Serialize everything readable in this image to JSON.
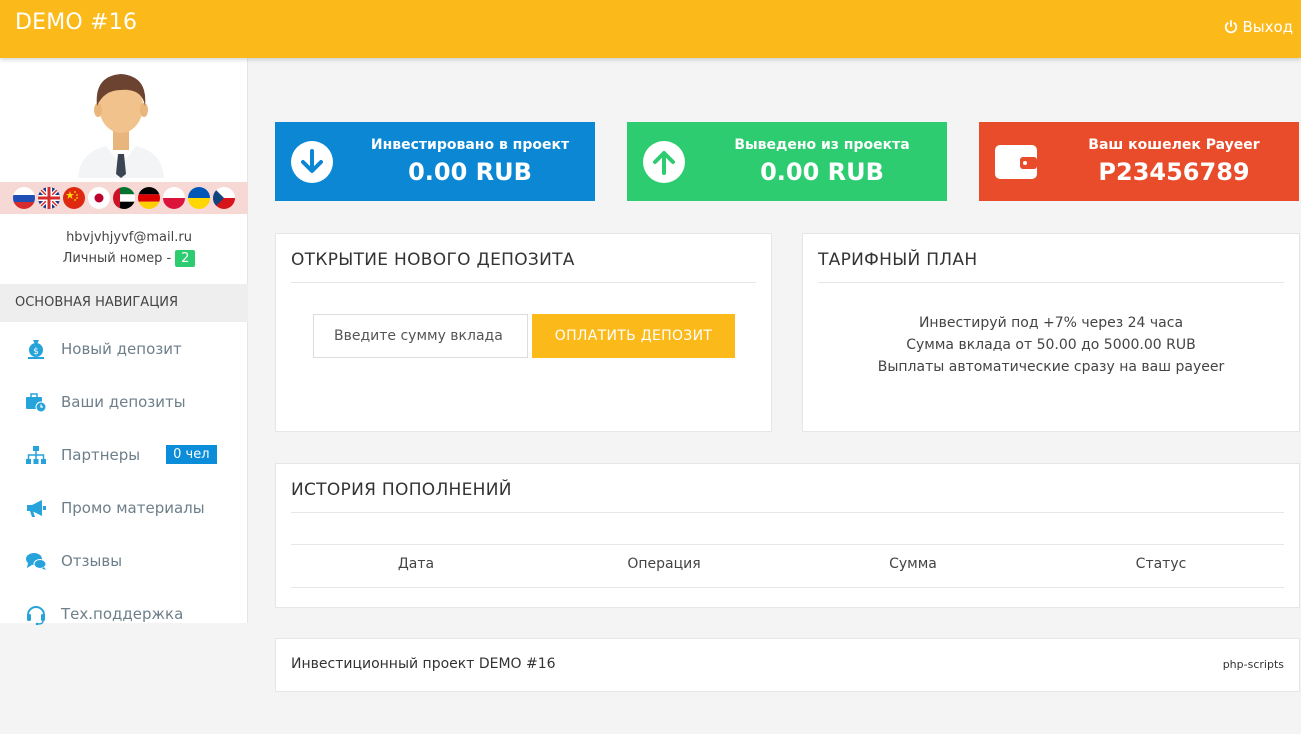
{
  "header": {
    "brand": "DEMO #16",
    "logout_label": "Выход",
    "bg_color": "#fbba1a"
  },
  "sidebar": {
    "flags": [
      "russia-flag",
      "uk-flag",
      "china-flag",
      "japan-flag",
      "uae-flag",
      "germany-flag",
      "poland-flag",
      "ukraine-flag",
      "czech-flag"
    ],
    "email": "hbvjvhjyvf@mail.ru",
    "personal_number_label": "Личный номер -",
    "personal_number": "2",
    "nav_heading": "ОСНОВНАЯ НАВИГАЦИЯ",
    "items": [
      {
        "label": "Новый депозит",
        "icon": "money-bag-icon"
      },
      {
        "label": "Ваши депозиты",
        "icon": "briefcase-clock-icon"
      },
      {
        "label": "Партнеры",
        "icon": "sitemap-icon",
        "badge": "0 чел"
      },
      {
        "label": "Промо материалы",
        "icon": "megaphone-icon"
      },
      {
        "label": "Отзывы",
        "icon": "comments-icon"
      },
      {
        "label": "Тех.поддержка",
        "icon": "headset-icon"
      }
    ]
  },
  "stats": [
    {
      "title": "Инвестировано в проект",
      "value": "0.00 RUB",
      "color": "#0b87d4",
      "icon": "arrow-down-circle-icon"
    },
    {
      "title": "Выведено из проекта",
      "value": "0.00 RUB",
      "color": "#2ecc71",
      "icon": "arrow-up-circle-icon"
    },
    {
      "title": "Ваш кошелек Payeer",
      "value": "P23456789",
      "color": "#e84c2b",
      "icon": "wallet-icon"
    }
  ],
  "deposit": {
    "title": "ОТКРЫТИЕ НОВОГО ДЕПОЗИТА",
    "placeholder": "Введите сумму вклада",
    "button": "ОПЛАТИТЬ ДЕПОЗИТ"
  },
  "tariff": {
    "title": "ТАРИФНЫЙ ПЛАН",
    "lines": [
      "Инвестируй под +7% через 24 часа",
      "Сумма вклада от 50.00 до 5000.00 RUB",
      "Выплаты автоматические сразу на ваш payeer"
    ]
  },
  "history": {
    "title": "ИСТОРИЯ ПОПОЛНЕНИЙ",
    "columns": [
      "Дата",
      "Операция",
      "Сумма",
      "Статус"
    ]
  },
  "footer": {
    "left": "Инвестиционный проект DEMO #16",
    "right": "php-scripts"
  }
}
